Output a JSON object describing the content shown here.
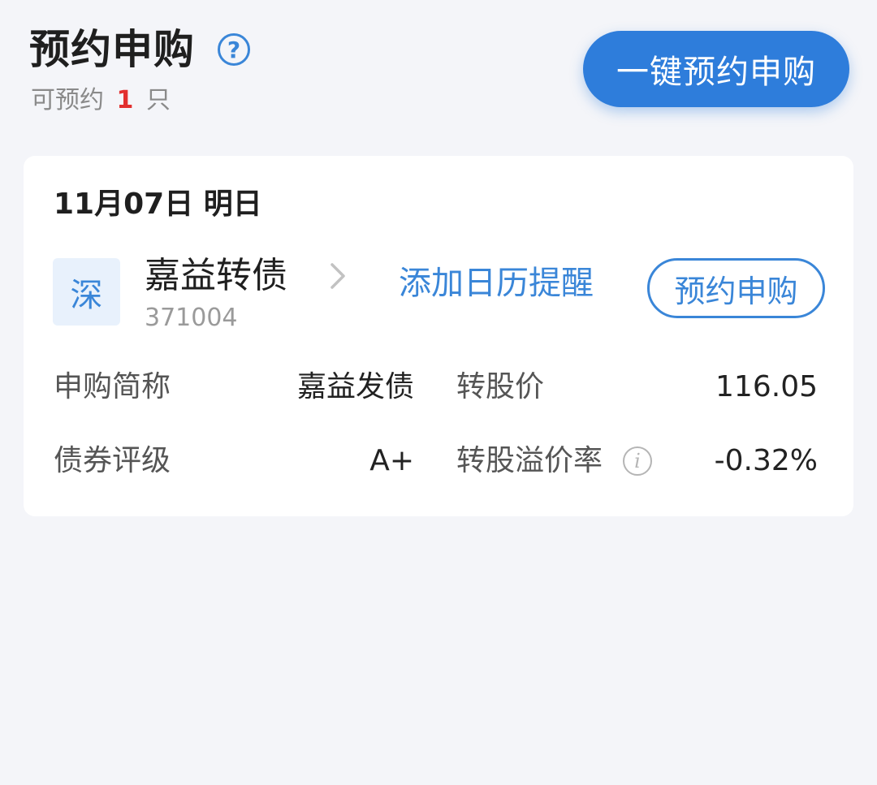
{
  "header": {
    "title": "预约申购",
    "subtitle_prefix": "可预约",
    "subtitle_count": "1",
    "subtitle_suffix": "只",
    "one_click_label": "一键预约申购"
  },
  "card": {
    "date": "11月07日",
    "day_label": "明日",
    "market": "深",
    "bond_name": "嘉益转债",
    "bond_code": "371004",
    "calendar_link": "添加日历提醒",
    "reserve_label": "预约申购",
    "fields": {
      "subscribe_abbr_label": "申购简称",
      "subscribe_abbr_value": "嘉益发债",
      "conversion_price_label": "转股价",
      "conversion_price_value": "116.05",
      "rating_label": "债券评级",
      "rating_value": "A+",
      "premium_rate_label": "转股溢价率",
      "premium_rate_value": "-0.32%"
    }
  },
  "icons": {
    "help": "question-circle-icon",
    "chevron": "chevron-right-icon",
    "info": "info-circle-icon"
  },
  "colors": {
    "accent": "#2e7ddb",
    "link": "#3a86d8",
    "highlight_count": "#e2302f",
    "background": "#f4f5f9"
  }
}
